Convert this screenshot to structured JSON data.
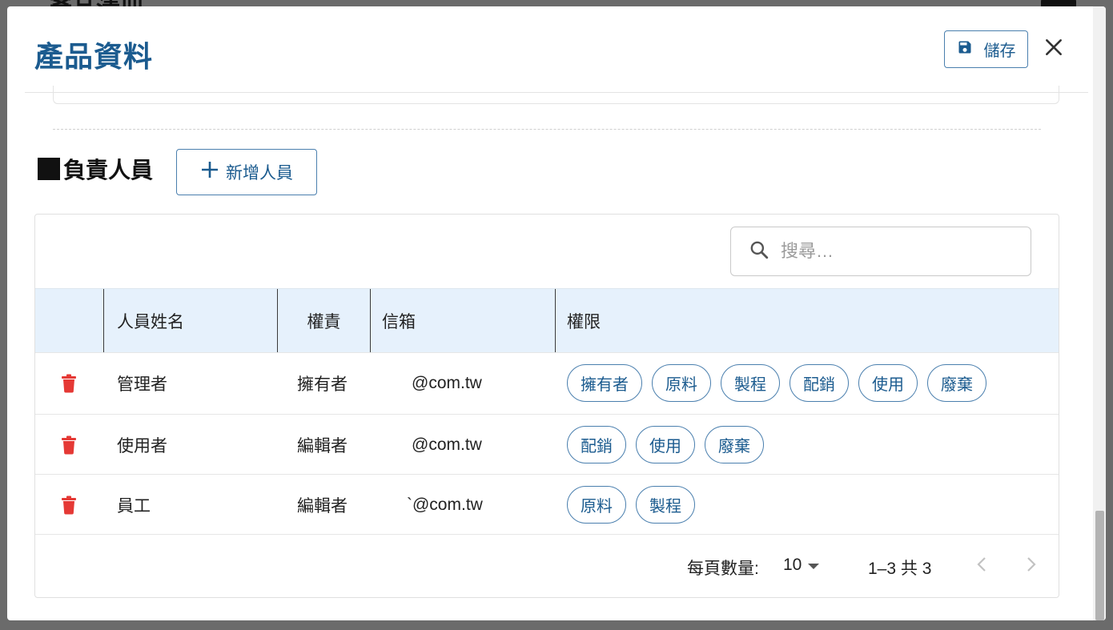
{
  "backdrop": {
    "title": "產品清冊"
  },
  "modal": {
    "title": "產品資料",
    "save_label": "儲存"
  },
  "section": {
    "title": "負責人員",
    "add_button_label": "新增人員"
  },
  "search": {
    "placeholder": "搜尋…"
  },
  "table": {
    "columns": [
      "人員姓名",
      "權責",
      "信箱",
      "權限"
    ],
    "rows": [
      {
        "name": "管理者",
        "role": "擁有者",
        "email": "@com.tw",
        "permissions": [
          "擁有者",
          "原料",
          "製程",
          "配銷",
          "使用",
          "廢棄"
        ]
      },
      {
        "name": "使用者",
        "role": "編輯者",
        "email": "@com.tw",
        "permissions": [
          "配銷",
          "使用",
          "廢棄"
        ]
      },
      {
        "name": "員工",
        "role": "編輯者",
        "email": "`@com.tw",
        "permissions": [
          "原料",
          "製程"
        ]
      }
    ]
  },
  "pagination": {
    "rows_per_page_label": "每頁數量:",
    "rows_per_page": "10",
    "range": "1–3 共 3"
  },
  "colors": {
    "primary": "#1b5b8f",
    "delete": "#e53935",
    "header_bg": "#e6f1fc"
  }
}
